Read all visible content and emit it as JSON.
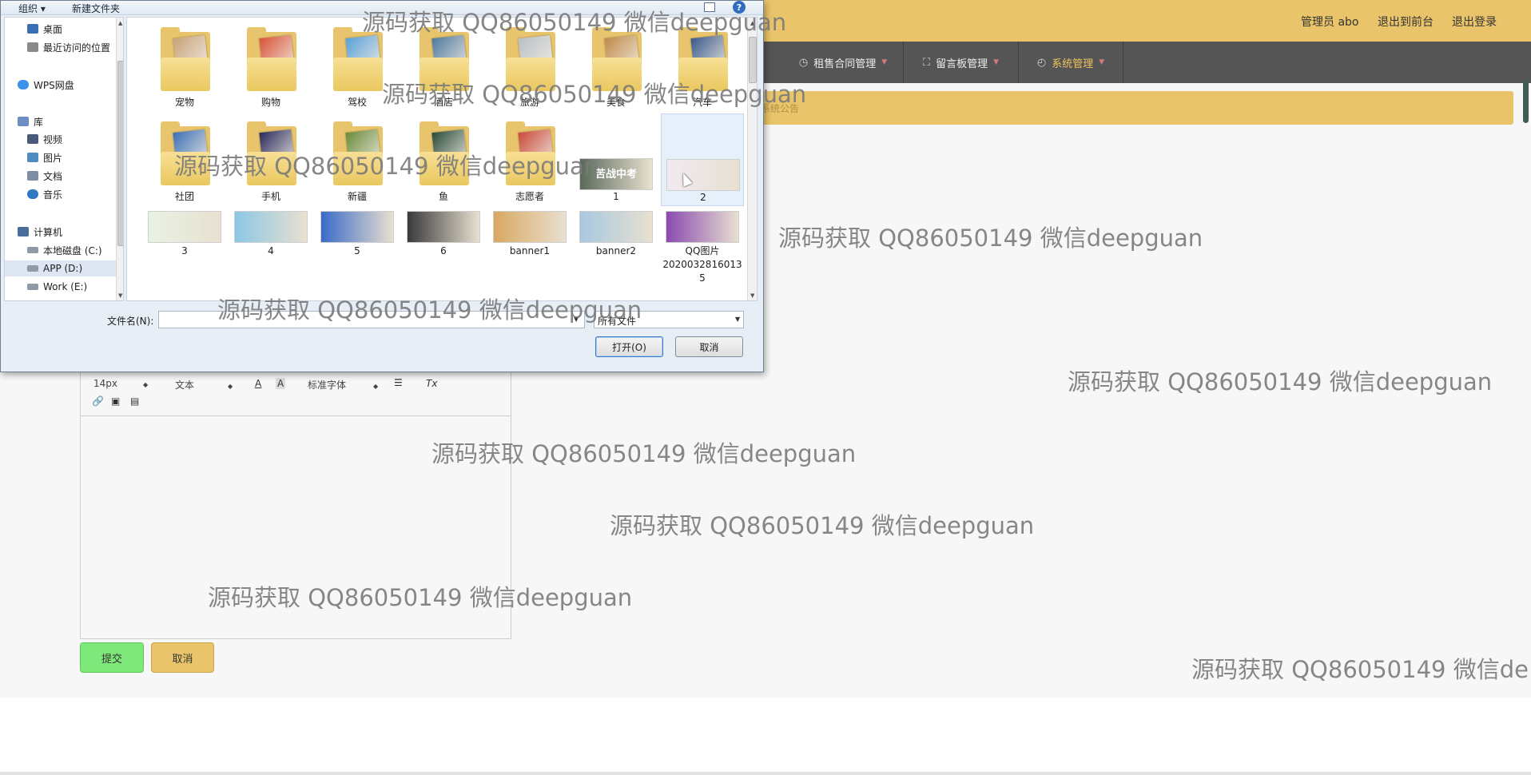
{
  "header": {
    "admin_label": "管理员 abo",
    "to_frontend": "退出到前台",
    "logout": "退出登录"
  },
  "nav": {
    "items": [
      {
        "label": "租售合同管理",
        "icon": "compass-icon"
      },
      {
        "label": "留言板管理",
        "icon": "expand-icon"
      },
      {
        "label": "系统管理",
        "icon": "clock-icon",
        "active": true
      }
    ]
  },
  "notice": {
    "label": "系统公告"
  },
  "editor": {
    "font_size": "14px",
    "block_format": "文本",
    "font_family": "标准字体",
    "color_btn": "A",
    "bgcolor_btn": "A",
    "clear_btn": "Tx"
  },
  "form": {
    "submit": "提交",
    "cancel": "取消"
  },
  "dialog": {
    "toolbar": {
      "organize": "组织",
      "new_folder": "新建文件夹",
      "help": "?"
    },
    "nav_pane": [
      {
        "label": "桌面",
        "color": "#3a6fb3"
      },
      {
        "label": "最近访问的位置",
        "color": "#8a8a8a"
      },
      {
        "label": "WPS网盘",
        "color": "#3c90e8"
      },
      {
        "label": "库",
        "color": "#6b8fc2"
      },
      {
        "label": "视频",
        "color": "#4a5a7a"
      },
      {
        "label": "图片",
        "color": "#4f8ac0"
      },
      {
        "label": "文档",
        "color": "#7f8ea2"
      },
      {
        "label": "音乐",
        "color": "#2f78c4"
      },
      {
        "label": "计算机",
        "color": "#4a6d99"
      },
      {
        "label": "本地磁盘 (C:)",
        "color": "#8e9aa8"
      },
      {
        "label": "APP (D:)",
        "color": "#8e9aa8",
        "selected": true
      },
      {
        "label": "Work (E:)",
        "color": "#8e9aa8"
      }
    ],
    "folders": [
      {
        "label": "宠物",
        "color": "#c8a27a"
      },
      {
        "label": "购物",
        "color": "#d8553a"
      },
      {
        "label": "驾校",
        "color": "#5aa0d8"
      },
      {
        "label": "酒店",
        "color": "#4e7a9e"
      },
      {
        "label": "旅游",
        "color": "#b8c0c6"
      },
      {
        "label": "美食",
        "color": "#c08a4a"
      },
      {
        "label": "汽车",
        "color": "#3a5a8a"
      },
      {
        "label": "社团",
        "color": "#3c6fb6"
      },
      {
        "label": "手机",
        "color": "#2a2a5a"
      },
      {
        "label": "新疆",
        "color": "#6a8a3a"
      },
      {
        "label": "鱼",
        "color": "#2a4a3a"
      },
      {
        "label": "志愿者",
        "color": "#c84a3a"
      }
    ],
    "images": [
      {
        "label": "1",
        "color": "#5a6a5a",
        "text": "苦战中考"
      },
      {
        "label": "2",
        "color": "#f0eaf2",
        "selected": true
      },
      {
        "label": "3",
        "color": "#e8f2e4"
      },
      {
        "label": "4",
        "color": "#8cc8e4"
      },
      {
        "label": "5",
        "color": "#3a6ac8"
      },
      {
        "label": "6",
        "color": "#3a3a3a"
      },
      {
        "label": "banner1",
        "color": "#d8a860"
      },
      {
        "label": "banner2",
        "color": "#a8c8e0"
      },
      {
        "label": "QQ图片",
        "label2": "2020032816013",
        "label3": "5",
        "color": "#8a4ab0"
      }
    ],
    "filename_label": "文件名(N):",
    "filename_value": "",
    "filter": "所有文件",
    "open_btn": "打开(O)",
    "cancel_btn": "取消"
  },
  "watermark": "源码获取 QQ86050149 微信deepguan",
  "watermark_cut": "源码获取 QQ86050149 微信de"
}
